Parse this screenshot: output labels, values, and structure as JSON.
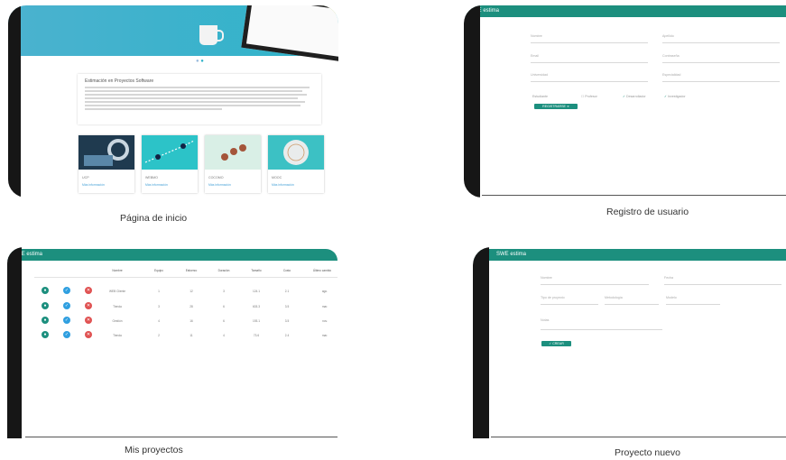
{
  "captions": {
    "home": "Página de inicio",
    "register": "Registro de usuario",
    "projects": "Mis proyectos",
    "new_project": "Proyecto nuevo"
  },
  "app_name": "SWE estima",
  "colors": {
    "brand": "#1c8f7e",
    "hero": "#2fb3c9",
    "edit": "#2f9fe0",
    "delete": "#e05252"
  },
  "home": {
    "intro_title": "Estimación en Proyectos Software",
    "cards": [
      {
        "title": "UCP",
        "link": "Más información"
      },
      {
        "title": "WEBMO",
        "link": "Más información"
      },
      {
        "title": "COCOMO",
        "link": "Más información"
      },
      {
        "title": "MOOC",
        "link": "Más información"
      }
    ]
  },
  "register": {
    "fields": [
      "Nombre",
      "Apellido",
      "Email",
      "Contraseña",
      "Universidad",
      "Especialidad"
    ],
    "checks": [
      "Estudiante",
      "Profesor",
      "Desarrollador",
      "Investigador"
    ],
    "submit": "REGISTRARSE"
  },
  "projects": {
    "headers": [
      "Nombre",
      "Equipo",
      "Esfuerzo",
      "Duración",
      "Tamaño",
      "Costo",
      "Último cambio"
    ],
    "rows": [
      {
        "name": "WEB Cliente",
        "vals": [
          "1",
          "12",
          "3",
          "124.1",
          "2.1",
          "ago."
        ]
      },
      {
        "name": "Tienda",
        "vals": [
          "3",
          "28",
          "6",
          "603.3",
          "3.5",
          "mar."
        ]
      },
      {
        "name": "Gestión",
        "vals": [
          "4",
          "16",
          "6",
          "193.1",
          "3.5",
          "nov."
        ]
      },
      {
        "name": "Tienda",
        "vals": [
          "2",
          "11",
          "4",
          "73.6",
          "2.4",
          "mar."
        ]
      }
    ]
  },
  "new_project": {
    "fields": [
      "Nombre",
      "Fecha",
      "Tipo de proyecto",
      "Metodología",
      "Modelo",
      "Notas"
    ],
    "submit": "CREAR"
  }
}
